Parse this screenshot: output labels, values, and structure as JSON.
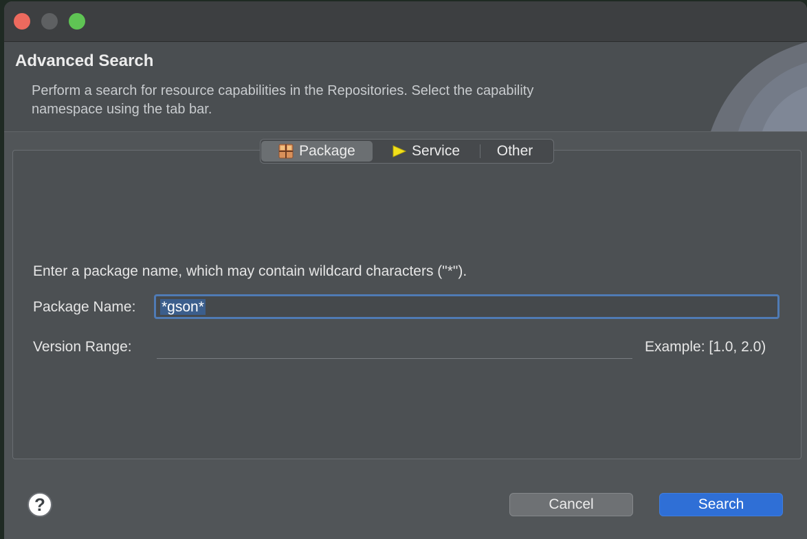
{
  "header": {
    "title": "Advanced Search",
    "description": "Perform a search for resource capabilities in the Repositories. Select the capability namespace using the tab bar."
  },
  "tabs": [
    {
      "label": "Package",
      "icon": "package-icon",
      "selected": true
    },
    {
      "label": "Service",
      "icon": "service-arrow-icon",
      "selected": false
    },
    {
      "label": "Other",
      "selected": false
    }
  ],
  "form": {
    "instruction": "Enter a package name, which may contain wildcard characters (\"*\").",
    "package_label": "Package Name:",
    "package_value": "*gson*",
    "version_label": "Version Range:",
    "version_value": "",
    "example": "Example: [1.0, 2.0)"
  },
  "buttons": {
    "help": "?",
    "cancel": "Cancel",
    "search": "Search"
  },
  "colors": {
    "accent": "#2f6fd6",
    "focus_ring": "#4f7bb5",
    "service_icon": "#f2e01b"
  }
}
